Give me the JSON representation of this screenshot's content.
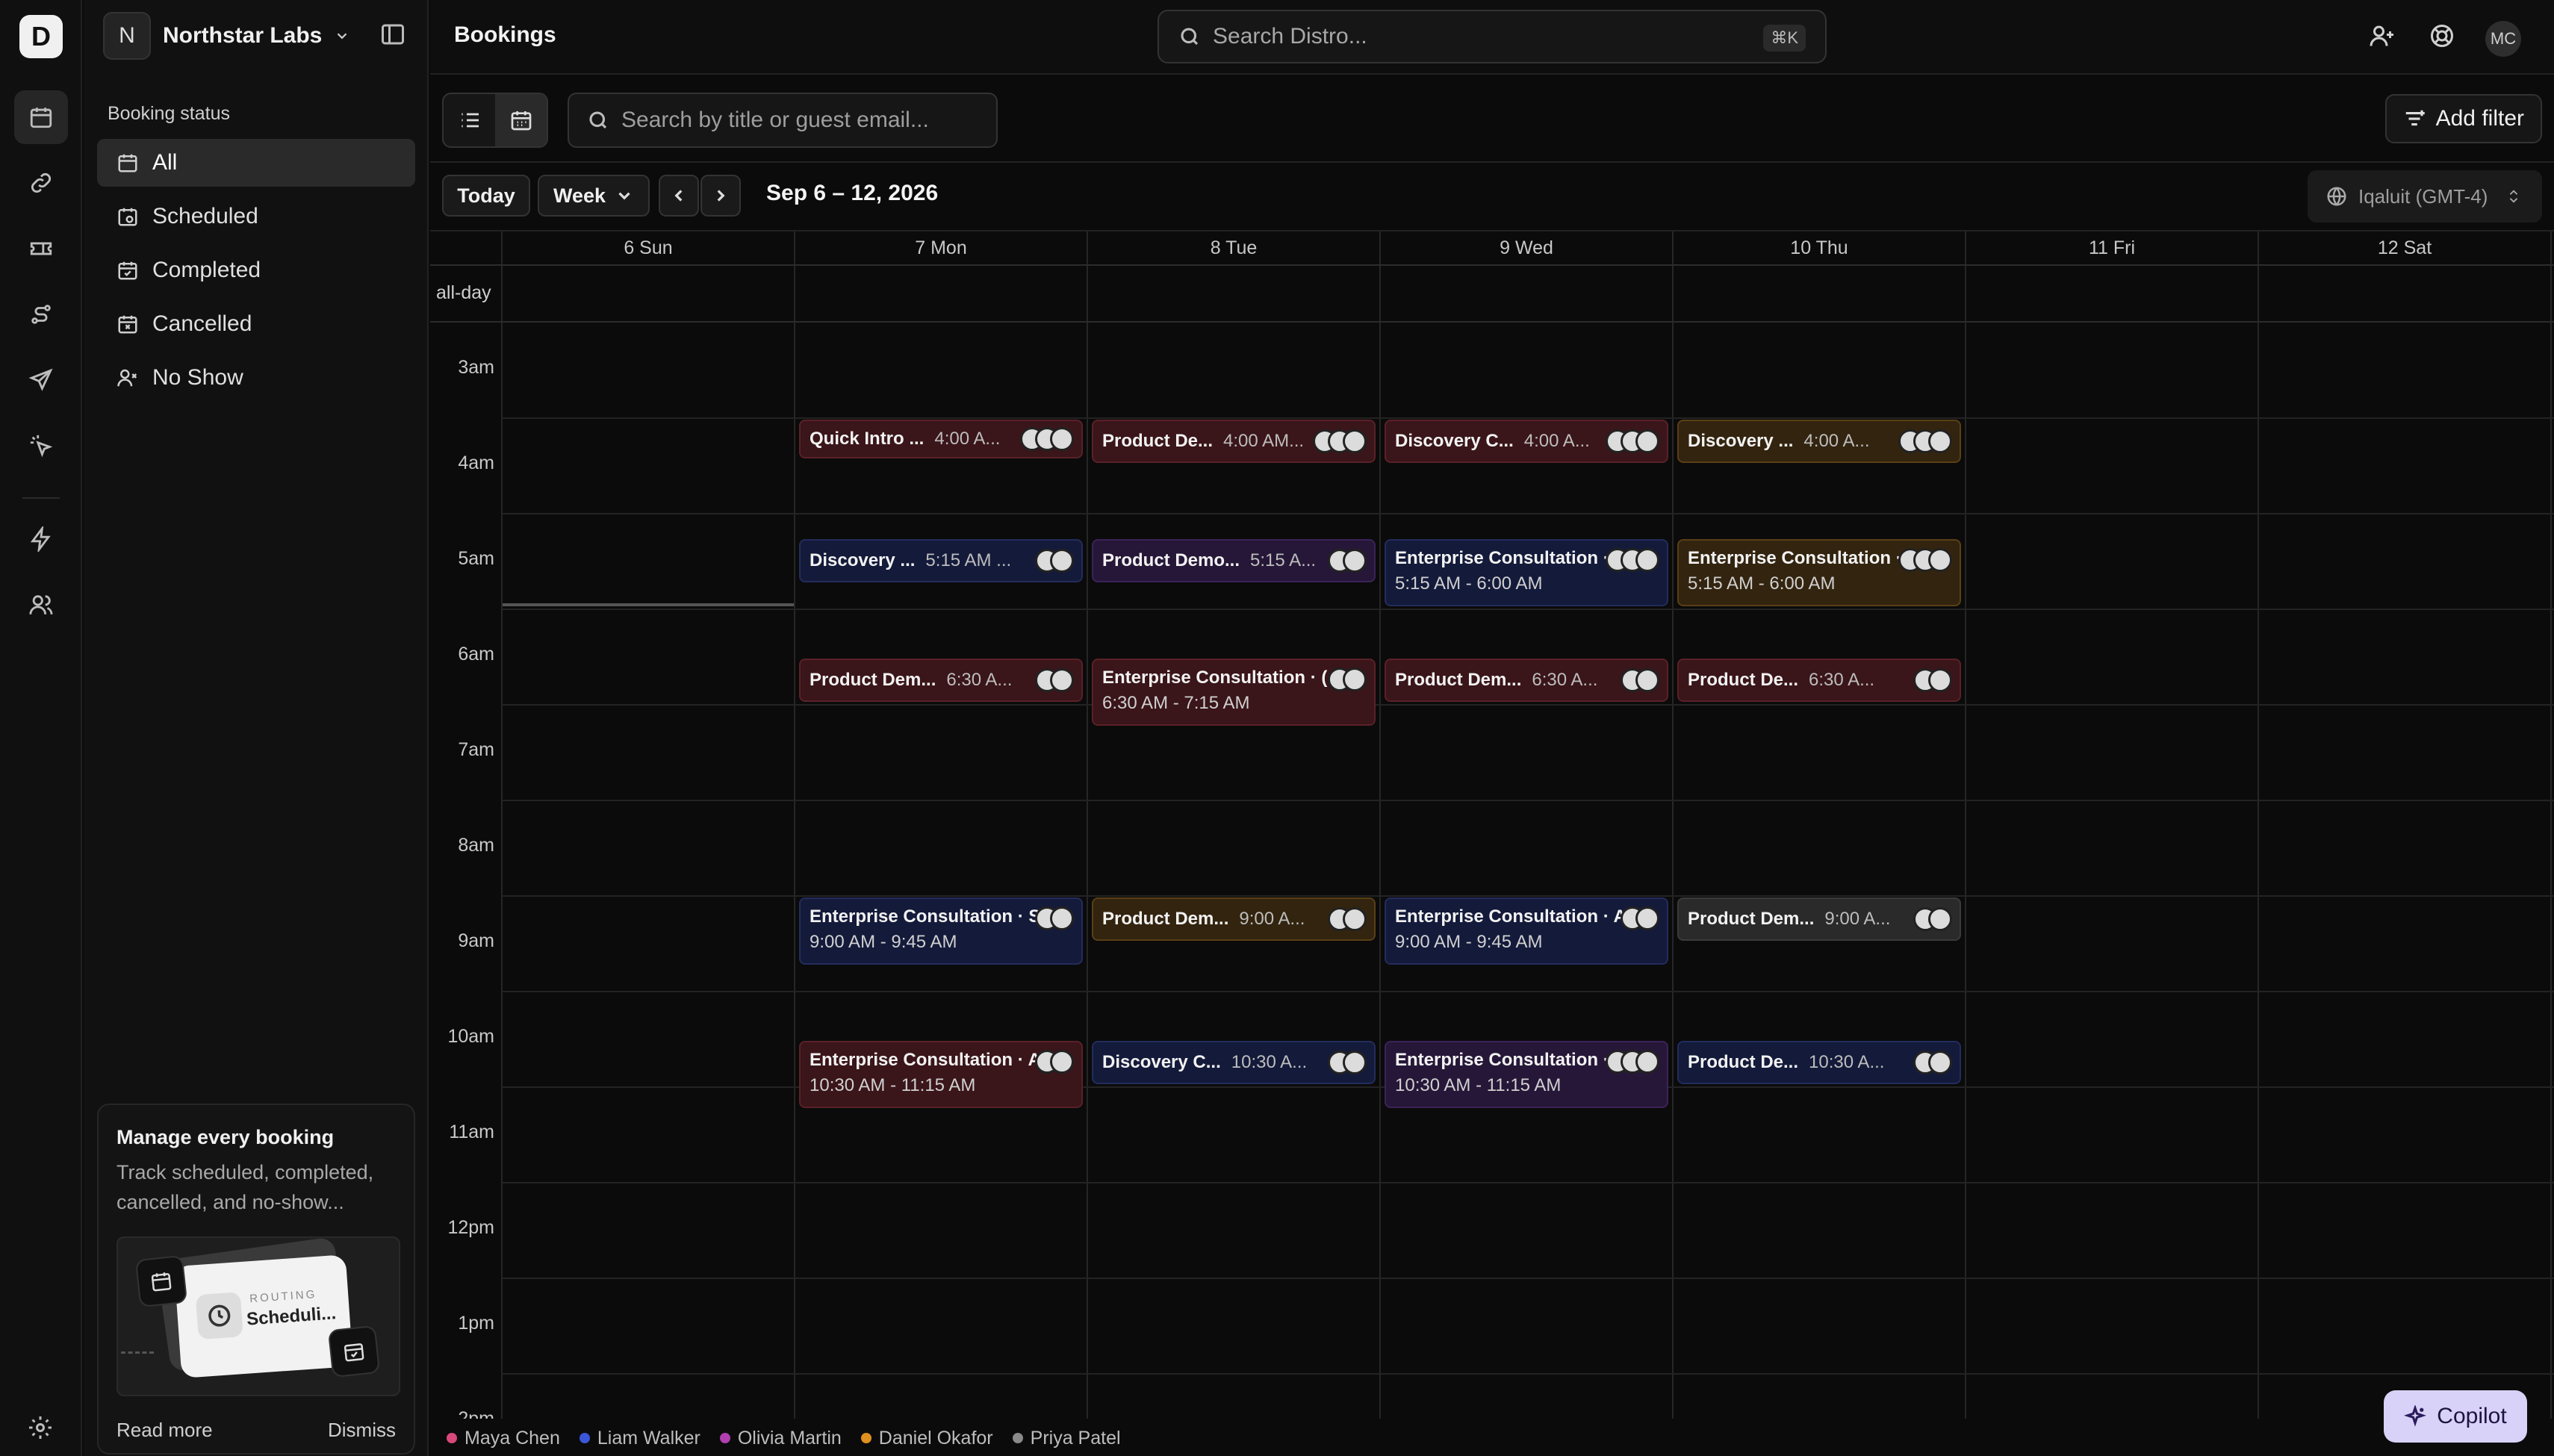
{
  "app": {
    "logo": "D"
  },
  "rail": {
    "icons": [
      "calendar-icon",
      "link-icon",
      "ticket-icon",
      "route-icon",
      "send-icon",
      "sparkle-cursor-icon",
      "lightning-icon",
      "users-icon"
    ],
    "settings_icon": "gear-icon"
  },
  "workspace": {
    "initial": "N",
    "name": "Northstar Labs"
  },
  "sidebar": {
    "section_label": "Booking status",
    "items": [
      {
        "label": "All",
        "icon": "calendar-icon",
        "selected": true
      },
      {
        "label": "Scheduled",
        "icon": "calendar-clock-icon"
      },
      {
        "label": "Completed",
        "icon": "calendar-check-icon"
      },
      {
        "label": "Cancelled",
        "icon": "calendar-x-icon"
      },
      {
        "label": "No Show",
        "icon": "user-x-icon"
      }
    ]
  },
  "promo": {
    "title": "Manage every booking",
    "description": "Track scheduled, completed, cancelled, and no-show...",
    "card_tag": "ROUTING",
    "card_title": "Scheduli...",
    "read_more": "Read more",
    "dismiss": "Dismiss"
  },
  "topbar": {
    "title": "Bookings",
    "search_placeholder": "Search Distro...",
    "shortcut": "⌘K",
    "avatar_initials": "MC"
  },
  "toolbar": {
    "search_placeholder": "Search by title or guest email...",
    "add_filter": "Add filter"
  },
  "calendar_nav": {
    "today": "Today",
    "view": "Week",
    "range": "Sep 6 – 12, 2026",
    "timezone": "Iqaluit (GMT-4)"
  },
  "calendar": {
    "days": [
      "6 Sun",
      "7 Mon",
      "8 Tue",
      "9 Wed",
      "10 Thu",
      "11 Fri",
      "12 Sat"
    ],
    "allday_label": "all-day",
    "hours": [
      "3am",
      "4am",
      "5am",
      "6am",
      "7am",
      "8am",
      "9am",
      "10am",
      "11am",
      "12pm",
      "1pm",
      "2pm"
    ],
    "events": [
      {
        "day": 1,
        "start": 4.0,
        "end": 4.4,
        "title": "Quick Intro ...",
        "time": "4:00 A...",
        "color": "red",
        "avatars": 3
      },
      {
        "day": 2,
        "start": 4.0,
        "end": 4.5,
        "title": "Product De...",
        "time": "4:00 AM...",
        "color": "red",
        "avatars": 3
      },
      {
        "day": 3,
        "start": 4.0,
        "end": 4.5,
        "title": "Discovery C...",
        "time": "4:00 A...",
        "color": "red",
        "avatars": 3
      },
      {
        "day": 4,
        "start": 4.0,
        "end": 4.5,
        "title": "Discovery ...",
        "time": "4:00 A...",
        "color": "orange",
        "avatars": 3
      },
      {
        "day": 1,
        "start": 5.25,
        "end": 5.75,
        "title": "Discovery ...",
        "time": "5:15 AM ...",
        "color": "blue",
        "avatars": 2
      },
      {
        "day": 2,
        "start": 5.25,
        "end": 5.75,
        "title": "Product Demo...",
        "time": "5:15 A...",
        "color": "purple",
        "avatars": 2
      },
      {
        "day": 3,
        "start": 5.25,
        "end": 6.0,
        "title": "Enterprise Consultation · V",
        "line2": "5:15 AM - 6:00 AM",
        "color": "blue",
        "avatars": 3
      },
      {
        "day": 4,
        "start": 5.25,
        "end": 6.0,
        "title": "Enterprise Consultation · I",
        "line2": "5:15 AM - 6:00 AM",
        "color": "orange",
        "avatars": 3
      },
      {
        "day": 1,
        "start": 6.5,
        "end": 7.0,
        "title": "Product Dem...",
        "time": "6:30 A...",
        "color": "red",
        "avatars": 2
      },
      {
        "day": 2,
        "start": 6.5,
        "end": 7.25,
        "title": "Enterprise Consultation · (",
        "line2": "6:30 AM - 7:15 AM",
        "color": "red",
        "avatars": 2
      },
      {
        "day": 3,
        "start": 6.5,
        "end": 7.0,
        "title": "Product Dem...",
        "time": "6:30 A...",
        "color": "red",
        "avatars": 2
      },
      {
        "day": 4,
        "start": 6.5,
        "end": 7.0,
        "title": "Product De...",
        "time": "6:30 A...",
        "color": "red",
        "avatars": 2
      },
      {
        "day": 1,
        "start": 9.0,
        "end": 9.75,
        "title": "Enterprise Consultation · S",
        "line2": "9:00 AM - 9:45 AM",
        "color": "blue",
        "avatars": 2
      },
      {
        "day": 2,
        "start": 9.0,
        "end": 9.5,
        "title": "Product Dem...",
        "time": "9:00 A...",
        "color": "orange",
        "avatars": 2
      },
      {
        "day": 3,
        "start": 9.0,
        "end": 9.75,
        "title": "Enterprise Consultation · A",
        "line2": "9:00 AM - 9:45 AM",
        "color": "blue",
        "avatars": 2
      },
      {
        "day": 4,
        "start": 9.0,
        "end": 9.5,
        "title": "Product Dem...",
        "time": "9:00 A...",
        "color": "gray",
        "avatars": 2
      },
      {
        "day": 1,
        "start": 10.5,
        "end": 11.25,
        "title": "Enterprise Consultation · A",
        "line2": "10:30 AM - 11:15 AM",
        "color": "red",
        "avatars": 2
      },
      {
        "day": 2,
        "start": 10.5,
        "end": 11.0,
        "title": "Discovery C...",
        "time": "10:30 A...",
        "color": "blue",
        "avatars": 2
      },
      {
        "day": 3,
        "start": 10.5,
        "end": 11.25,
        "title": "Enterprise Consultation · I",
        "line2": "10:30 AM - 11:15 AM",
        "color": "purple",
        "avatars": 3
      },
      {
        "day": 4,
        "start": 10.5,
        "end": 11.0,
        "title": "Product De...",
        "time": "10:30 A...",
        "color": "blue",
        "avatars": 2
      }
    ]
  },
  "legend": [
    {
      "name": "Maya Chen",
      "color": "#d9487a"
    },
    {
      "name": "Liam Walker",
      "color": "#3b56d9"
    },
    {
      "name": "Olivia Martin",
      "color": "#b03fb0"
    },
    {
      "name": "Daniel Okafor",
      "color": "#e0901f"
    },
    {
      "name": "Priya Patel",
      "color": "#8a8a8a"
    }
  ],
  "copilot": {
    "label": "Copilot"
  }
}
